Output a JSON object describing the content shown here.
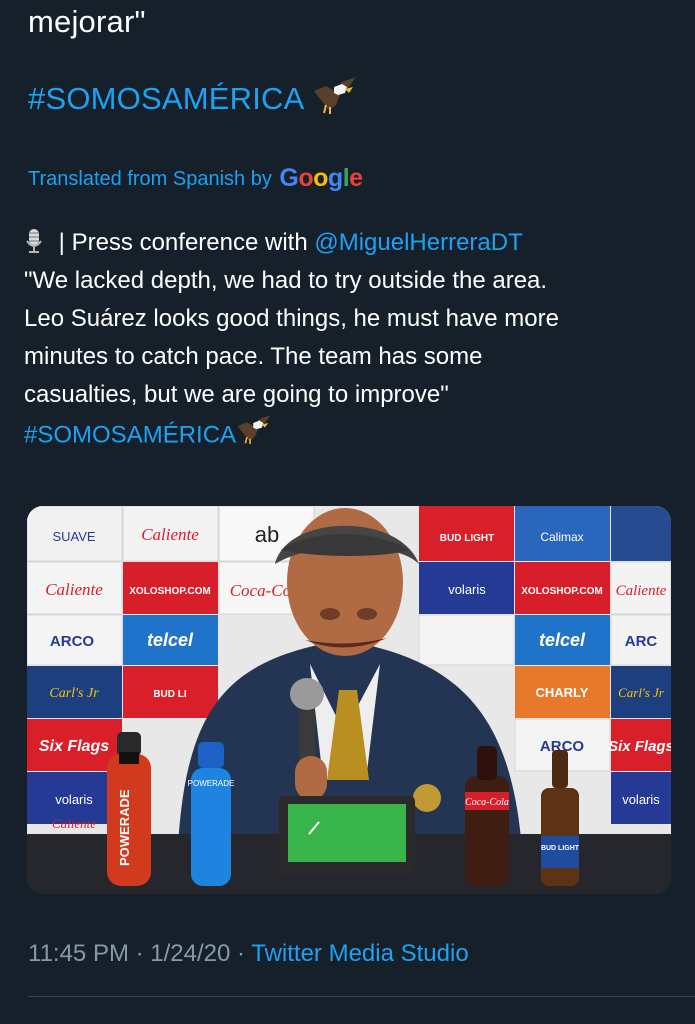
{
  "tweet": {
    "original_line1": "mejorar\"",
    "original_hashtag": "#SOMOSAMÉRICA",
    "translated_by_label": "Translated from Spanish by",
    "google_logo": [
      "G",
      "o",
      "o",
      "g",
      "l",
      "e"
    ],
    "translation": {
      "intro": " | Press conference with ",
      "mention": "@MiguelHerreraDT",
      "line2": "\"We lacked depth, we had to try outside the area.",
      "line3": "Leo Suárez looks good things, he must have more",
      "line4": "minutes to catch pace. The team has some",
      "line5": "casualties, but we are going to improve\"",
      "hashtag": "#SOMOSAMÉRICA"
    },
    "media": {
      "sponsor_texts": [
        "SUAVE",
        "Caliente",
        "ab",
        "BUD LIGHT",
        "Calimax",
        "Caliente",
        "XOLOSHOP.COM",
        "Coca-Cola",
        "volaris",
        "XOLOSHOP.COM",
        "Caliente",
        "ARCO",
        "telcel",
        "telcel",
        "ARC",
        "Carl's Jr",
        "BUD LI",
        "CHARLY",
        "Carl's Jr",
        "Six Flags",
        "ARCO",
        "Six Flags",
        "volaris",
        "volaris",
        "Caliente"
      ],
      "bottle_labels": {
        "powerade": "POWERADE",
        "powerade_small": "POWERADE",
        "coca_cola": "Coca-Cola",
        "bud_light": "BUD LIGHT"
      }
    },
    "timestamp": "11:45 PM · 1/24/20 · ",
    "source": "Twitter Media Studio"
  },
  "colors": {
    "background": "#15202b",
    "link": "#1da1f2",
    "meta": "#8899a6",
    "divider": "#38444d"
  },
  "icons": [
    "eagle-emoji-icon",
    "microphone-emoji-icon",
    "google-logo"
  ]
}
